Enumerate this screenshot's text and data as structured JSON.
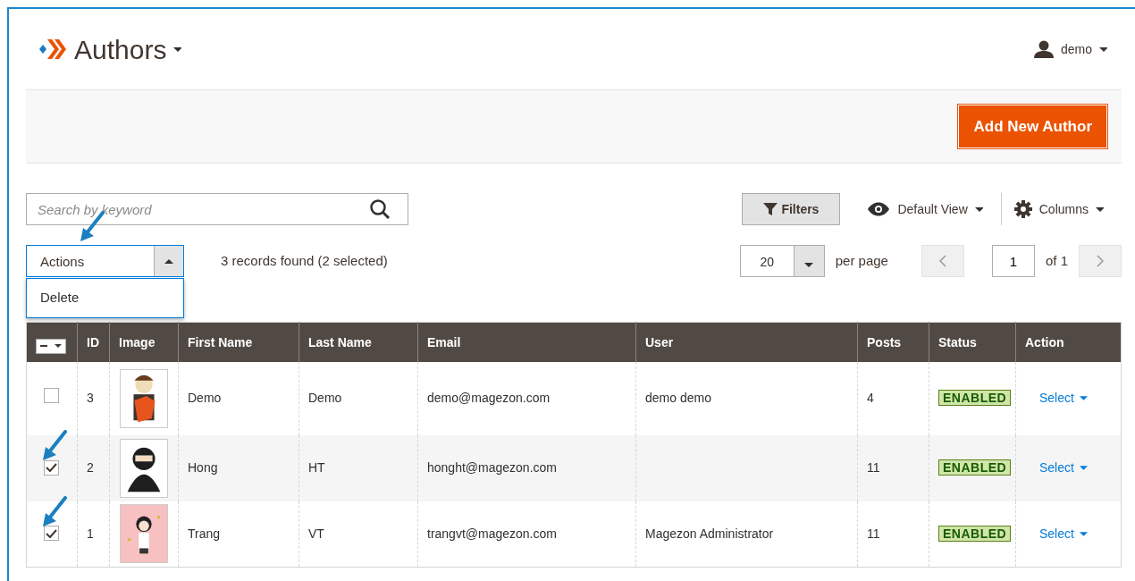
{
  "header": {
    "title": "Authors",
    "user": "demo"
  },
  "toolbar": {
    "add_button": "Add New Author"
  },
  "search": {
    "placeholder": "Search by keyword"
  },
  "controls": {
    "filters": "Filters",
    "view": "Default View",
    "columns": "Columns"
  },
  "actions": {
    "label": "Actions",
    "expanded": true,
    "options": [
      "Delete"
    ]
  },
  "records": "3 records found (2 selected)",
  "pager": {
    "per_page": "20",
    "per_page_label": "per page",
    "page": "1",
    "of": "of 1"
  },
  "table": {
    "mass_select": {
      "indeterminate": true
    },
    "columns": [
      "ID",
      "Image",
      "First Name",
      "Last Name",
      "Email",
      "User",
      "Posts",
      "Status",
      "Action"
    ],
    "rows": [
      {
        "selected": false,
        "id": "3",
        "first_name": "Demo",
        "last_name": "Demo",
        "email": "demo@magezon.com",
        "user": "demo demo",
        "posts": "4",
        "status": "ENABLED",
        "action": "Select"
      },
      {
        "selected": true,
        "id": "2",
        "first_name": "Hong",
        "last_name": "HT",
        "email": "honght@magezon.com",
        "posts": "11",
        "status": "ENABLED",
        "action": "Select"
      },
      {
        "selected": true,
        "id": "1",
        "first_name": "Trang",
        "last_name": "VT",
        "email": "trangvt@magezon.com",
        "user": "Magezon Administrator",
        "posts": "11",
        "status": "ENABLED",
        "action": "Select"
      }
    ]
  }
}
